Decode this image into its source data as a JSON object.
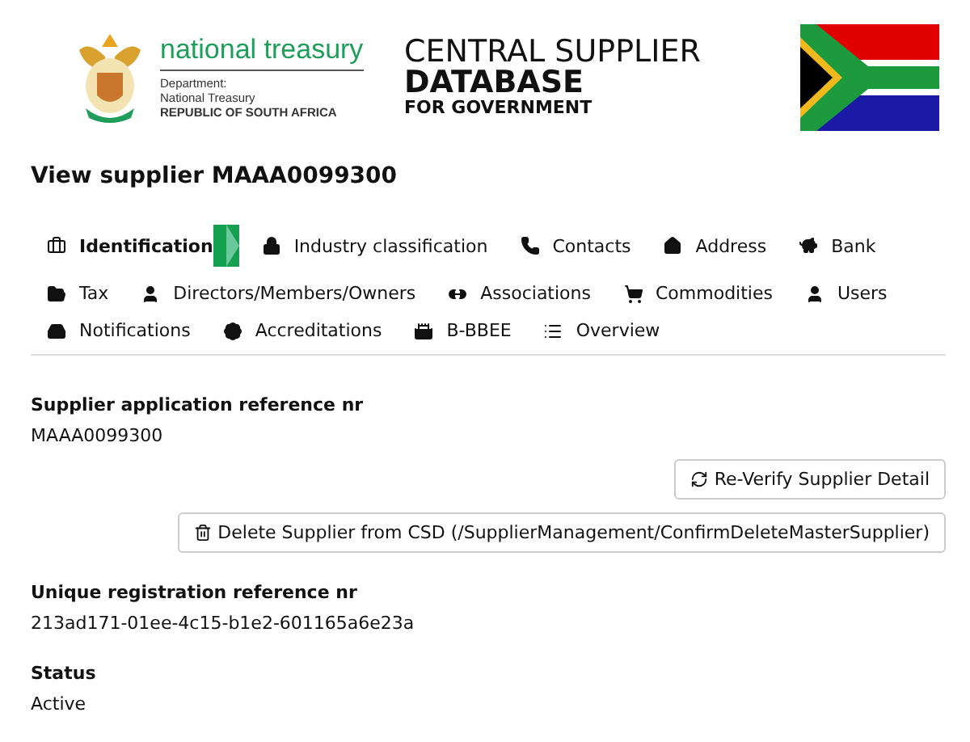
{
  "header": {
    "org_name": "national treasury",
    "org_lines": [
      "Department:",
      "National Treasury",
      "REPUBLIC OF SOUTH AFRICA"
    ],
    "title_lines": [
      "CENTRAL SUPPLIER",
      "DATABASE",
      "FOR GOVERNMENT"
    ]
  },
  "page_title": "View supplier MAAA0099300",
  "tabs": [
    [
      {
        "label": "Identification",
        "selected": true
      },
      {
        "label": "Industry classification",
        "selected": false
      },
      {
        "label": "Contacts",
        "selected": false
      },
      {
        "label": "Address",
        "selected": false
      },
      {
        "label": "Bank",
        "selected": false
      }
    ],
    [
      {
        "label": "Tax",
        "selected": false
      },
      {
        "label": "Directors/Members/Owners",
        "selected": false
      },
      {
        "label": "Associations",
        "selected": false
      },
      {
        "label": "Commodities",
        "selected": false
      },
      {
        "label": "Users",
        "selected": false
      }
    ],
    [
      {
        "label": "Notifications",
        "selected": false
      },
      {
        "label": "Accreditations",
        "selected": false
      },
      {
        "label": "B-BBEE",
        "selected": false
      },
      {
        "label": "Overview",
        "selected": false
      }
    ]
  ],
  "fields": [
    {
      "label": "Supplier application reference nr",
      "value": "MAAA0099300"
    }
  ],
  "buttons": [
    "Re-Verify Supplier Detail",
    "Delete Supplier from CSD (/SupplierManagement/ConfirmDeleteMasterSupplier)"
  ],
  "more_fields": [
    {
      "label": "Unique registration reference nr",
      "value": "213ad171-01ee-4c15-b1e2-601165a6e23a"
    },
    {
      "label": "Status",
      "value": "Active"
    }
  ]
}
